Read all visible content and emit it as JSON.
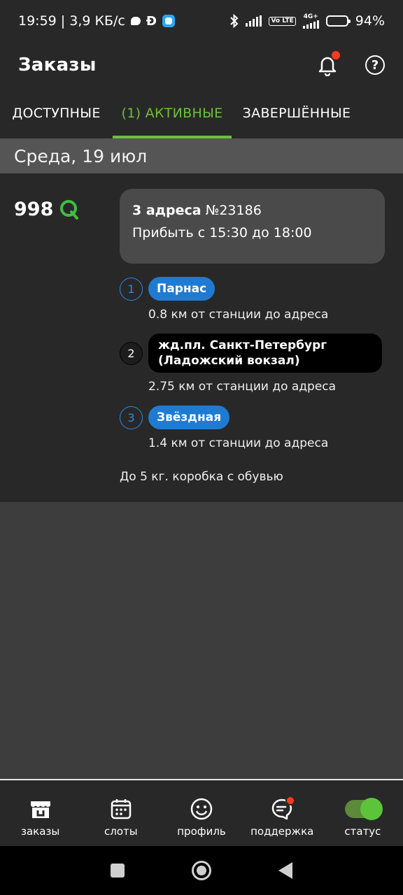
{
  "status_bar": {
    "time_speed": "19:59 | 3,9 КБ/с",
    "d_icon": "Ð",
    "volte": "Vo LTE",
    "network": "4G+",
    "battery": "94%"
  },
  "header": {
    "title": "Заказы",
    "help_symbol": "?"
  },
  "tabs": [
    {
      "label": "ДОСТУПНЫЕ",
      "active": false
    },
    {
      "label": "(1) АКТИВНЫЕ",
      "active": true
    },
    {
      "label": "ЗАВЕРШЁННЫЕ",
      "active": false
    }
  ],
  "date_header": "Среда, 19 июл",
  "order": {
    "price": "998",
    "address_count": "3 адреса",
    "number": "№23186",
    "arrival": "Прибыть с 15:30 до 18:00",
    "stops": [
      {
        "num": "1",
        "station": "Парнас",
        "distance": "0.8 км от станции до адреса"
      },
      {
        "num": "2",
        "station": "жд.пл. Санкт-Петербург (Ладожский вокзал)",
        "distance": "2.75 км от станции до адреса"
      },
      {
        "num": "3",
        "station": "Звёздная",
        "distance": "1.4 км от станции до адреса"
      }
    ],
    "cargo": "До 5 кг. коробка с обувью"
  },
  "bottom_nav": [
    {
      "label": "заказы",
      "icon": "store-icon"
    },
    {
      "label": "слоты",
      "icon": "calendar-icon"
    },
    {
      "label": "профиль",
      "icon": "smiley-icon"
    },
    {
      "label": "поддержка",
      "icon": "support-chat-icon"
    },
    {
      "label": "статус",
      "icon": "toggle-icon"
    }
  ],
  "colors": {
    "accent_green": "#6ac13a",
    "chip_blue": "#1f7bd1",
    "notification_red": "#ff3b1f"
  }
}
